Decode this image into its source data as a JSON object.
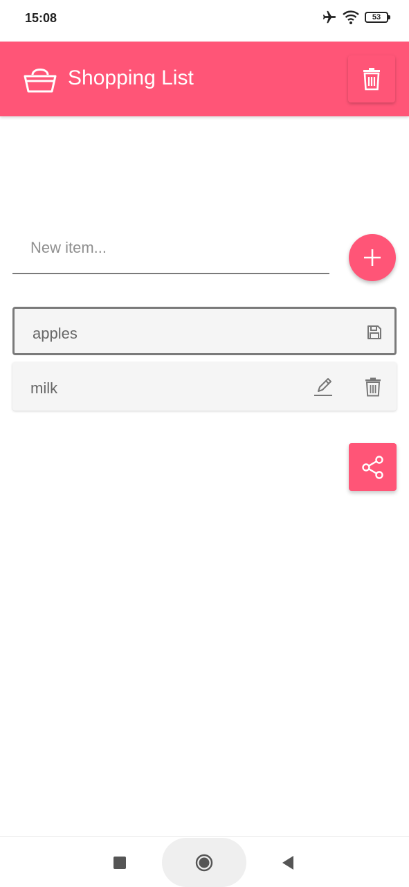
{
  "status_bar": {
    "time": "15:08",
    "battery": "53",
    "icons": [
      "airplane-icon",
      "wifi-icon",
      "battery-icon"
    ]
  },
  "app_bar": {
    "title": "Shopping List",
    "logo_icon": "basket-icon",
    "action_icon": "trash-icon",
    "color": "#ff5577"
  },
  "new_item": {
    "placeholder": "New item...",
    "value": "",
    "add_icon": "plus-icon"
  },
  "items": [
    {
      "label": "apples",
      "state": "editing",
      "actions": [
        "save-icon"
      ]
    },
    {
      "label": "milk",
      "state": "normal",
      "actions": [
        "pencil-icon",
        "trash-icon"
      ]
    }
  ],
  "share": {
    "icon": "share-icon"
  },
  "nav_bar": {
    "buttons": [
      "recents-icon",
      "home-icon",
      "back-icon"
    ]
  }
}
